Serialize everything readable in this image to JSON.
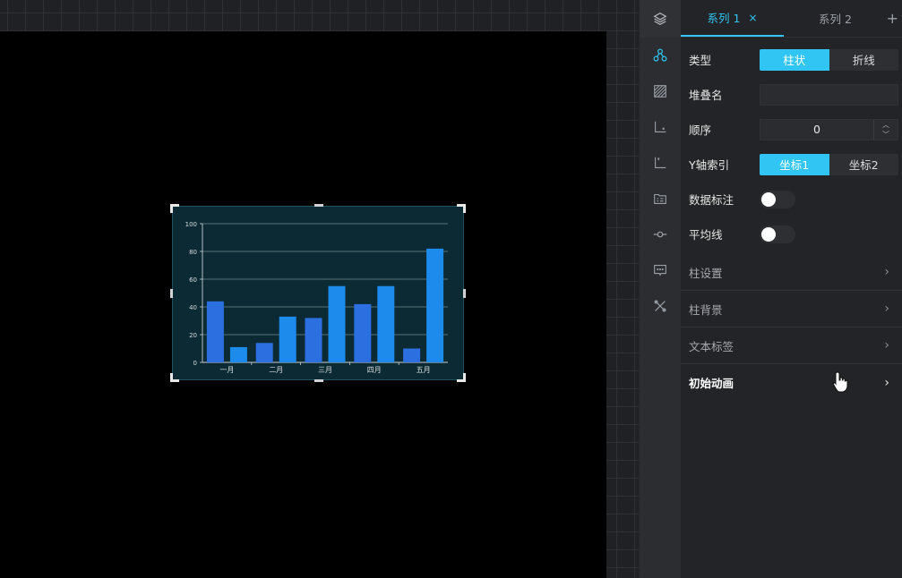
{
  "panel": {
    "tabs": [
      {
        "label": "系列 1",
        "active": true
      },
      {
        "label": "系列 2",
        "active": false
      }
    ],
    "close_glyph": "×",
    "add_glyph": "+",
    "fields": {
      "type_label": "类型",
      "type_options": [
        "柱状",
        "折线"
      ],
      "stack_label": "堆叠名",
      "stack_value": "",
      "order_label": "顺序",
      "order_value": "0",
      "yaxis_label": "Y轴索引",
      "yaxis_options": [
        "坐标1",
        "坐标2"
      ],
      "data_label_label": "数据标注",
      "avg_line_label": "平均线"
    },
    "sections": [
      "柱设置",
      "柱背景",
      "文本标签",
      "初始动画"
    ]
  },
  "rail_icons": [
    "layers-icon",
    "series-icon",
    "texture-icon",
    "x-axis-icon",
    "y-axis-icon",
    "legend-icon",
    "marker-icon",
    "tooltip-icon",
    "tools-icon"
  ],
  "colors": {
    "accent": "#30c5f2",
    "bar_dark": "#2b6fe0",
    "bar_light": "#1d8bec",
    "chart_bg": "#0c2a33"
  },
  "chart_data": {
    "type": "bar",
    "categories": [
      "一月",
      "二月",
      "三月",
      "四月",
      "五月"
    ],
    "series": [
      {
        "values": [
          44,
          14,
          32,
          42,
          10
        ]
      },
      {
        "values": [
          11,
          33,
          55,
          55,
          82
        ]
      }
    ],
    "ylim": [
      0,
      100
    ],
    "yticks": [
      0,
      20,
      40,
      60,
      80,
      100
    ],
    "grid": true
  }
}
